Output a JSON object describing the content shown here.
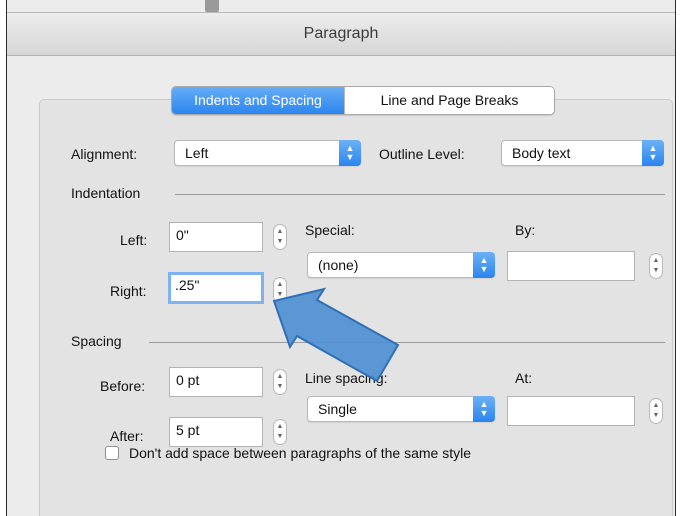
{
  "window": {
    "title": "Paragraph"
  },
  "tabs": [
    {
      "label": "Indents and Spacing",
      "active": true
    },
    {
      "label": "Line and Page Breaks",
      "active": false
    }
  ],
  "general": {
    "alignment_label": "Alignment:",
    "alignment_value": "Left",
    "outline_label": "Outline Level:",
    "outline_value": "Body text"
  },
  "indentation": {
    "header": "Indentation",
    "left_label": "Left:",
    "left_value": "0\"",
    "right_label": "Right:",
    "right_value": ".25\"",
    "special_label": "Special:",
    "special_value": "(none)",
    "by_label": "By:",
    "by_value": ""
  },
  "spacing": {
    "header": "Spacing",
    "before_label": "Before:",
    "before_value": "0 pt",
    "after_label": "After:",
    "after_value": "5 pt",
    "line_spacing_label": "Line spacing:",
    "line_spacing_value": "Single",
    "at_label": "At:",
    "at_value": ""
  },
  "checkbox": {
    "label": "Don't add space between paragraphs of the same style",
    "checked": false
  },
  "annotation": {
    "icon": "pointer-arrow-icon",
    "color": "#4f90d4"
  },
  "colors": {
    "accent": "#2c86ee",
    "focus_ring": "#7fb2f0"
  }
}
